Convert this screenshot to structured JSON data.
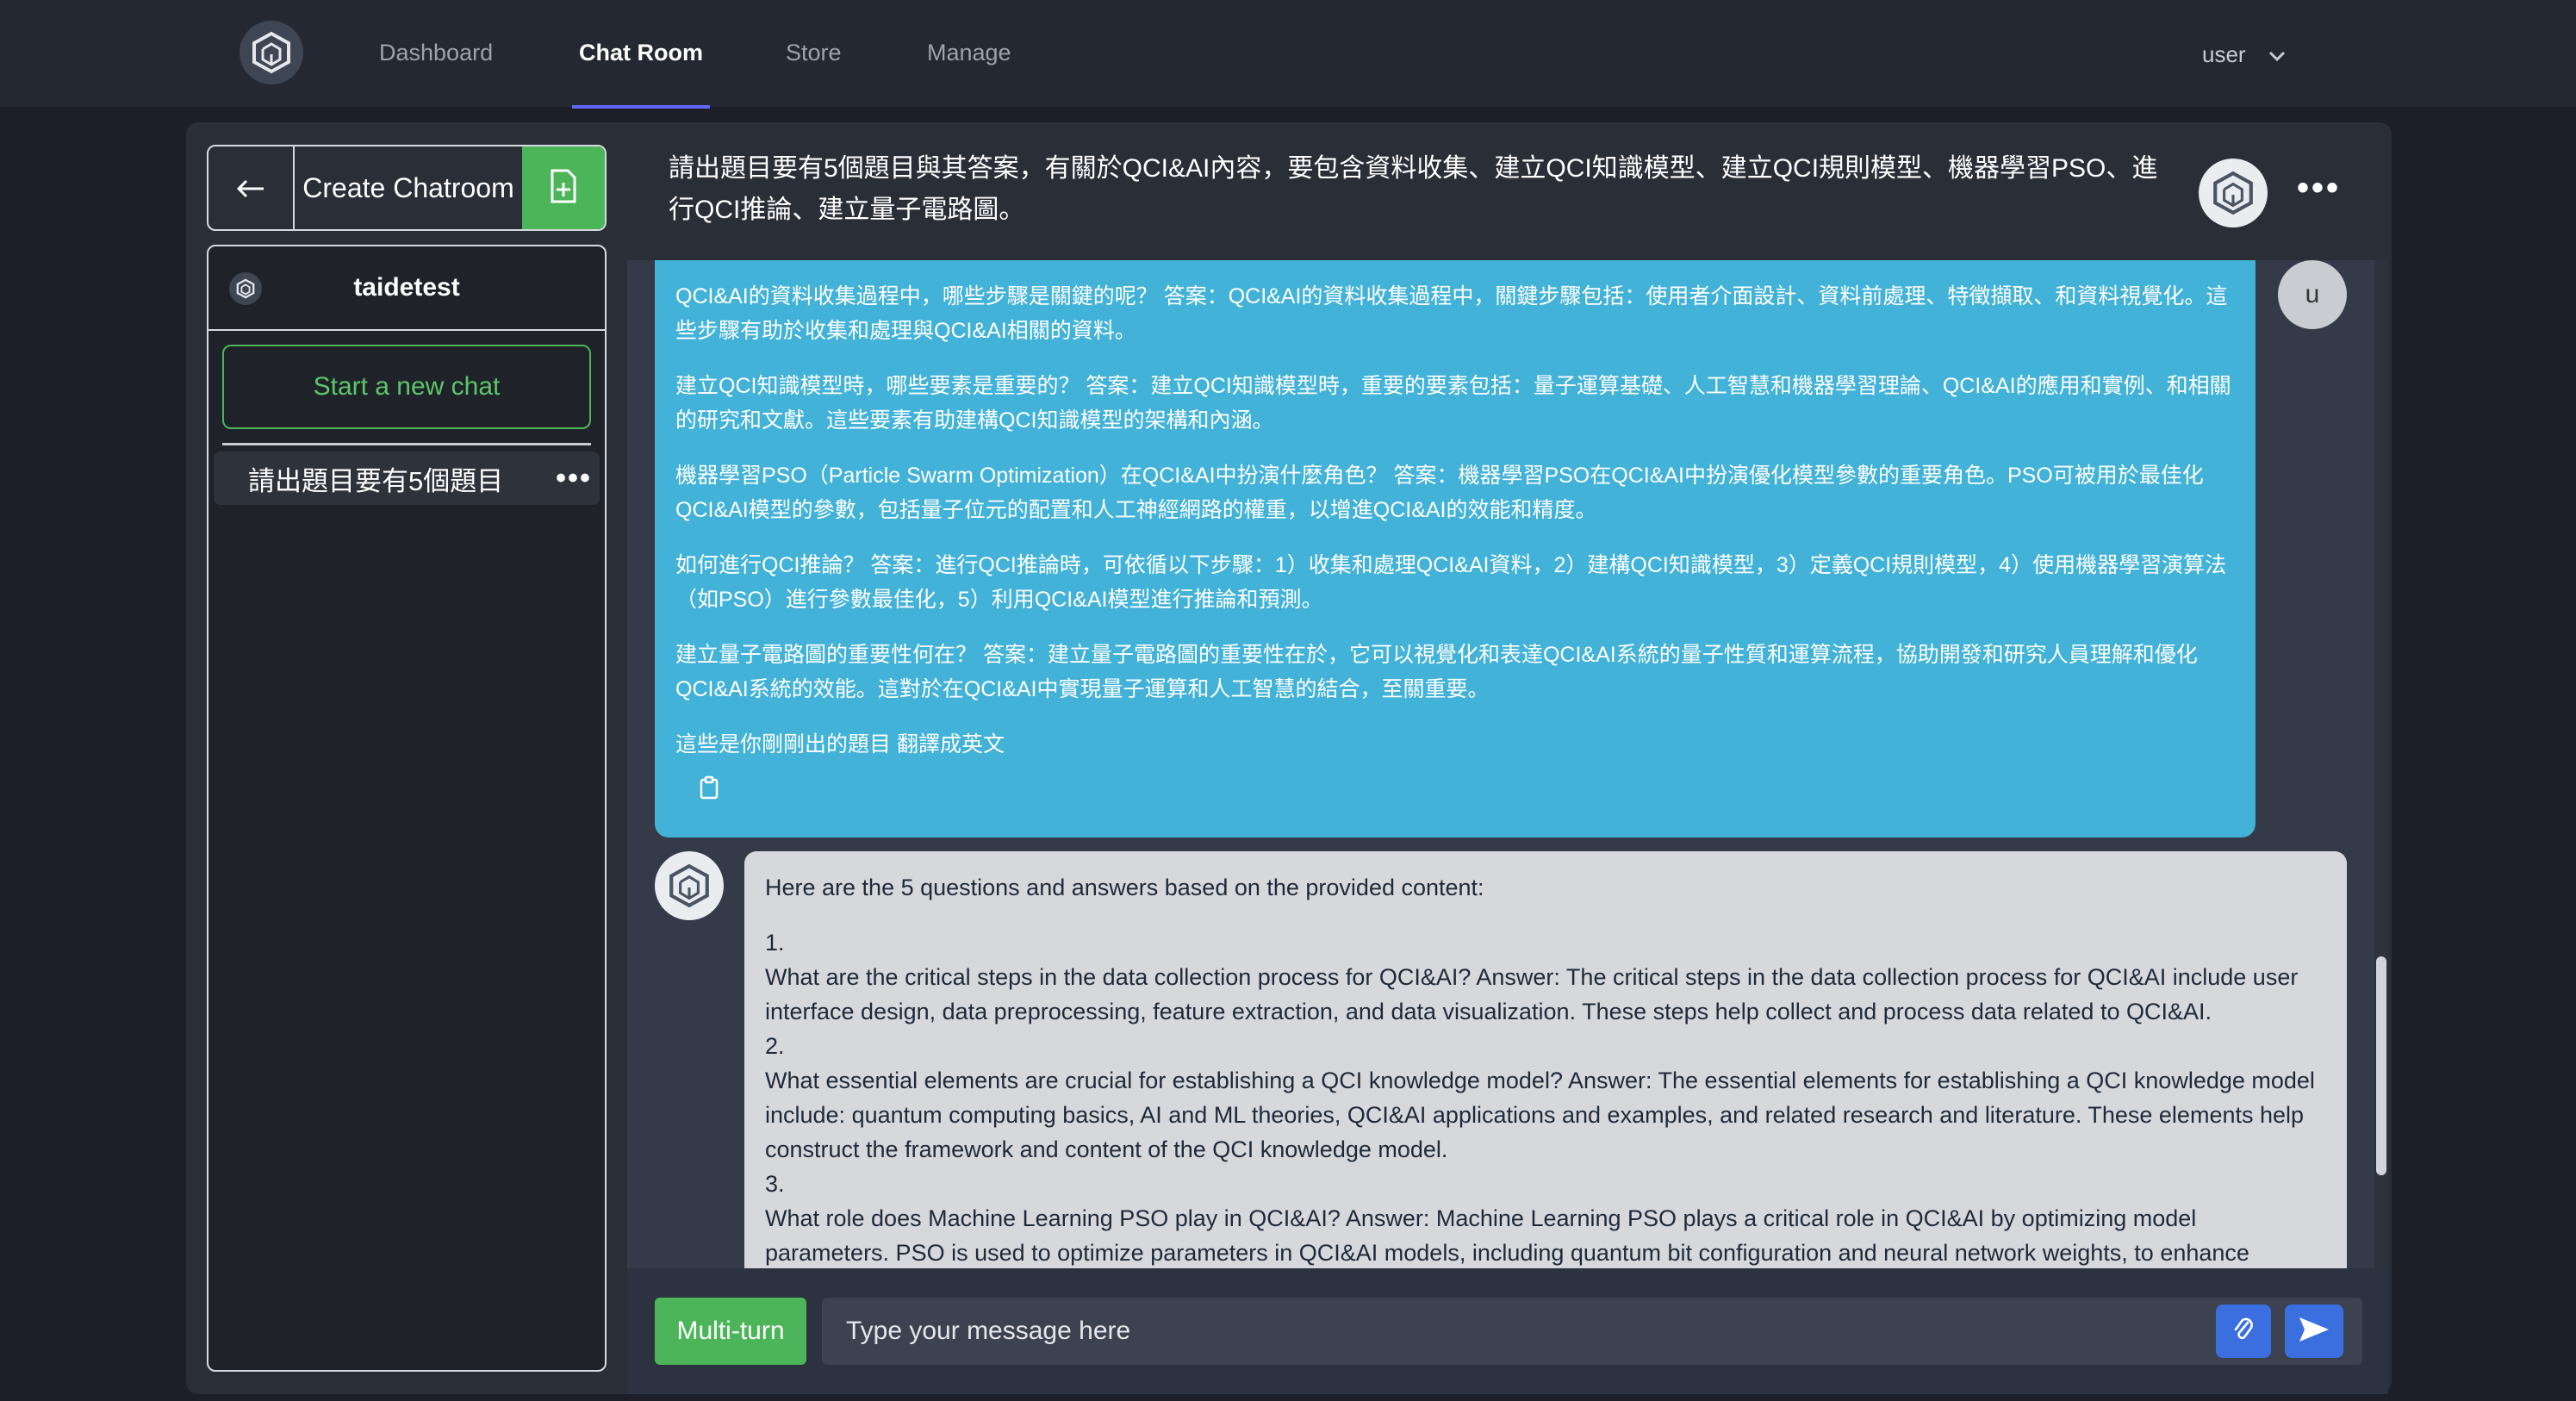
{
  "nav": {
    "items": [
      {
        "label": "Dashboard",
        "active": false
      },
      {
        "label": "Chat Room",
        "active": true
      },
      {
        "label": "Store",
        "active": false
      },
      {
        "label": "Manage",
        "active": false
      }
    ],
    "user_label": "user",
    "logo_icon": "cube-logo-icon"
  },
  "sidebar": {
    "create_label": "Create Chatroom",
    "back_icon": "arrow-left-icon",
    "create_icon": "add-file-icon",
    "room_name": "taidetest",
    "new_chat_label": "Start a new chat",
    "chats": [
      {
        "label": "請出題目要有5個題目"
      }
    ]
  },
  "header": {
    "title": "請出題目要有5個題目與其答案，有關於QCI&AI內容，要包含資料收集、建立QCI知識模型、建立QCI規則模型、機器學習PSO、進行QCI推論、建立量子電路圖。"
  },
  "messages": {
    "user": {
      "avatar_letter": "u",
      "paragraphs": [
        "QCI&AI的資料收集過程中，哪些步驟是關鍵的呢？ 答案：QCI&AI的資料收集過程中，關鍵步驟包括：使用者介面設計、資料前處理、特徵擷取、和資料視覺化。這些步驟有助於收集和處理與QCI&AI相關的資料。",
        "建立QCI知識模型時，哪些要素是重要的？ 答案：建立QCI知識模型時，重要的要素包括：量子運算基礎、人工智慧和機器學習理論、QCI&AI的應用和實例、和相關的研究和文獻。這些要素有助建構QCI知識模型的架構和內涵。",
        "機器學習PSO（Particle Swarm Optimization）在QCI&AI中扮演什麼角色？ 答案：機器學習PSO在QCI&AI中扮演優化模型參數的重要角色。PSO可被用於最佳化QCI&AI模型的參數，包括量子位元的配置和人工神經網路的權重，以增進QCI&AI的效能和精度。",
        "如何進行QCI推論？ 答案：進行QCI推論時，可依循以下步驟：1）收集和處理QCI&AI資料，2）建構QCI知識模型，3）定義QCI規則模型，4）使用機器學習演算法（如PSO）進行參數最佳化，5）利用QCI&AI模型進行推論和預測。",
        "建立量子電路圖的重要性何在？ 答案：建立量子電路圖的重要性在於，它可以視覺化和表達QCI&AI系統的量子性質和運算流程，協助開發和研究人員理解和優化QCI&AI系統的效能。這對於在QCI&AI中實現量子運算和人工智慧的結合，至關重要。",
        "這些是你剛剛出的題目 翻譯成英文"
      ]
    },
    "bot": {
      "intro": "Here are the 5 questions and answers based on the provided content:",
      "items": [
        {
          "num": "1.",
          "text": "What are the critical steps in the data collection process for QCI&AI? Answer: The critical steps in the data collection process for QCI&AI include user interface design, data preprocessing, feature extraction, and data visualization. These steps help collect and process data related to QCI&AI."
        },
        {
          "num": "2.",
          "text": "What essential elements are crucial for establishing a QCI knowledge model? Answer: The essential elements for establishing a QCI knowledge model include: quantum computing basics, AI and ML theories, QCI&AI applications and examples, and related research and literature. These elements help construct the framework and content of the QCI knowledge model."
        },
        {
          "num": "3.",
          "text": "What role does Machine Learning PSO play in QCI&AI? Answer: Machine Learning PSO plays a critical role in QCI&AI by optimizing model parameters. PSO is used to optimize parameters in QCI&AI models, including quantum bit configuration and neural network weights, to enhance"
        }
      ]
    }
  },
  "input": {
    "mode_label": "Multi-turn",
    "placeholder": "Type your message here"
  },
  "colors": {
    "accent_green": "#4cb55a",
    "user_bubble": "#42b2d8",
    "bot_bubble": "#d6d8dc",
    "send_blue": "#3b6fe0",
    "nav_active_underline": "#6366f1"
  }
}
